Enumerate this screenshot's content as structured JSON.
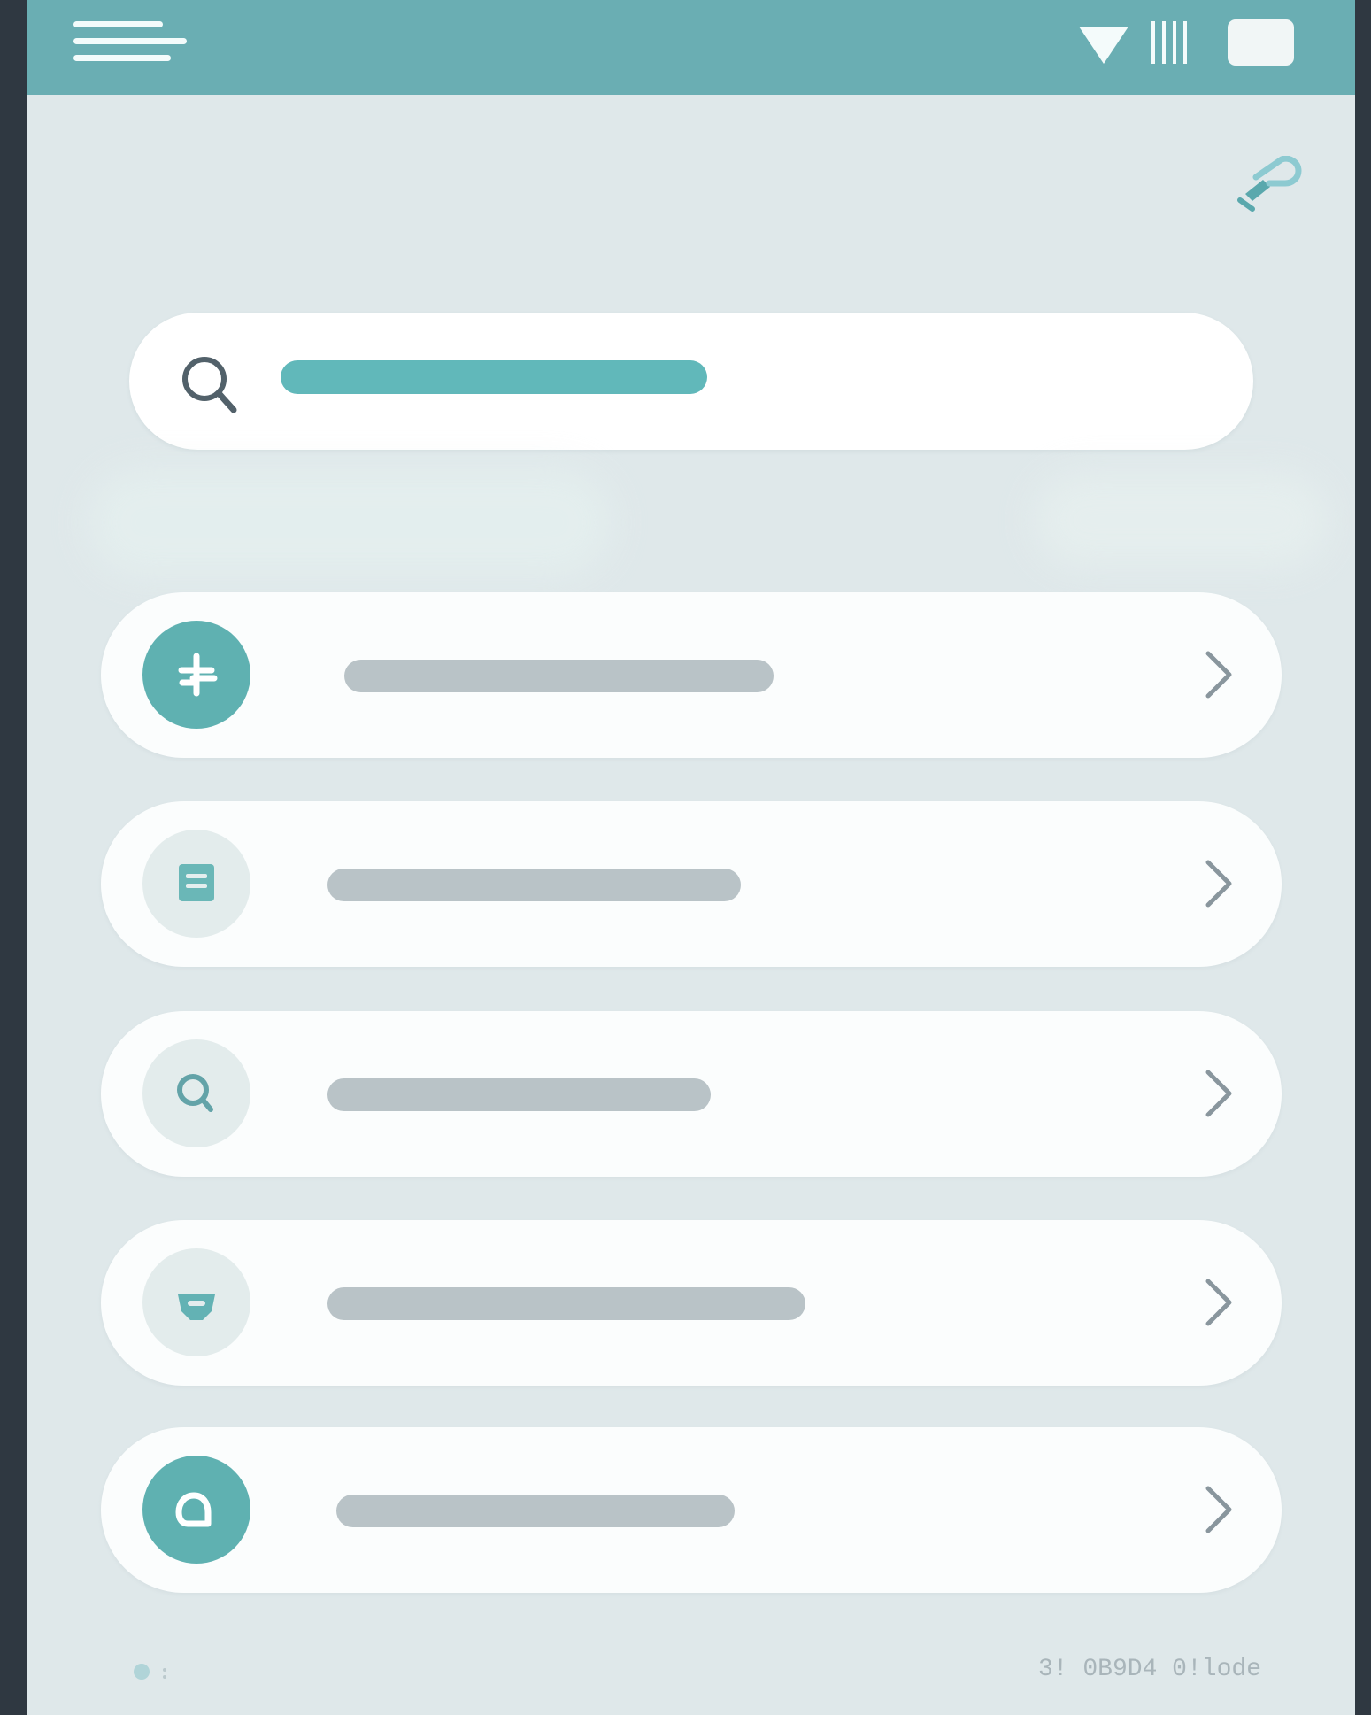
{
  "header": {
    "menu_icon": "hamburger-menu-icon",
    "status_icons": [
      "wifi-icon",
      "signal-icon",
      "battery-icon"
    ],
    "color": "#6AAEB3"
  },
  "toolbar": {
    "tool_icon": "pen-tool-icon"
  },
  "search": {
    "icon": "search-icon",
    "value": "",
    "accent_color": "#61B8BA"
  },
  "list": {
    "items": [
      {
        "icon": "plus-icon",
        "label": "",
        "chevron_icon": "chevron-right-icon"
      },
      {
        "icon": "document-icon",
        "label": "",
        "chevron_icon": "chevron-right-icon"
      },
      {
        "icon": "magnifier-icon",
        "label": "",
        "chevron_icon": "chevron-right-icon"
      },
      {
        "icon": "mask-icon",
        "label": "",
        "chevron_icon": "chevron-right-icon"
      },
      {
        "icon": "letter-a-icon",
        "label": "",
        "chevron_icon": "chevron-right-icon"
      }
    ]
  },
  "footer": {
    "left_icon": "settings-icon",
    "right_text": "3! 0B9D4 0!lode"
  }
}
